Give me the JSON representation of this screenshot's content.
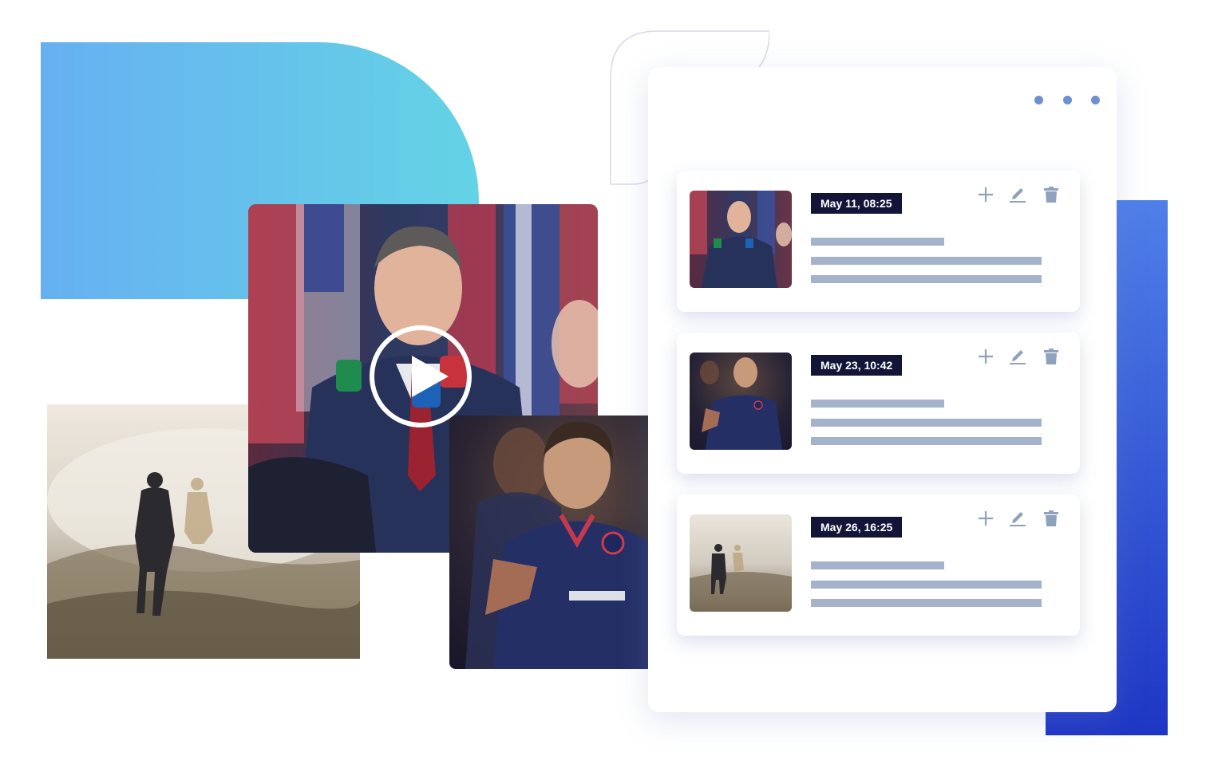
{
  "colors": {
    "accent_gradient_start": "#66b0f2",
    "accent_gradient_end": "#64d3e5",
    "bar_top": "#4f7fe8",
    "bar_bottom": "#1e36c4",
    "date_badge_bg": "#121538",
    "placeholder_line": "#a4b3cb",
    "icon": "#8fa1bd",
    "menu_dot": "#6e8fd1"
  },
  "media": {
    "images": [
      {
        "name": "firefighter-photo",
        "subject": "firefighter walking through smoke in a field"
      },
      {
        "name": "press-conference-photo",
        "subject": "man speaking to microphones in front of flags"
      },
      {
        "name": "soccer-photo",
        "subject": "soccer player in dark blue jersey running"
      }
    ],
    "play_icon": "play-icon"
  },
  "panel": {
    "menu_icon": "more-horizontal-icon",
    "cards": [
      {
        "date": "May 11, 08:25",
        "thumbnail": "press-conference"
      },
      {
        "date": "May 23, 10:42",
        "thumbnail": "soccer"
      },
      {
        "date": "May 26, 16:25",
        "thumbnail": "firefighter"
      }
    ],
    "card_actions": [
      "plus-icon",
      "pencil-icon",
      "trash-icon"
    ]
  }
}
